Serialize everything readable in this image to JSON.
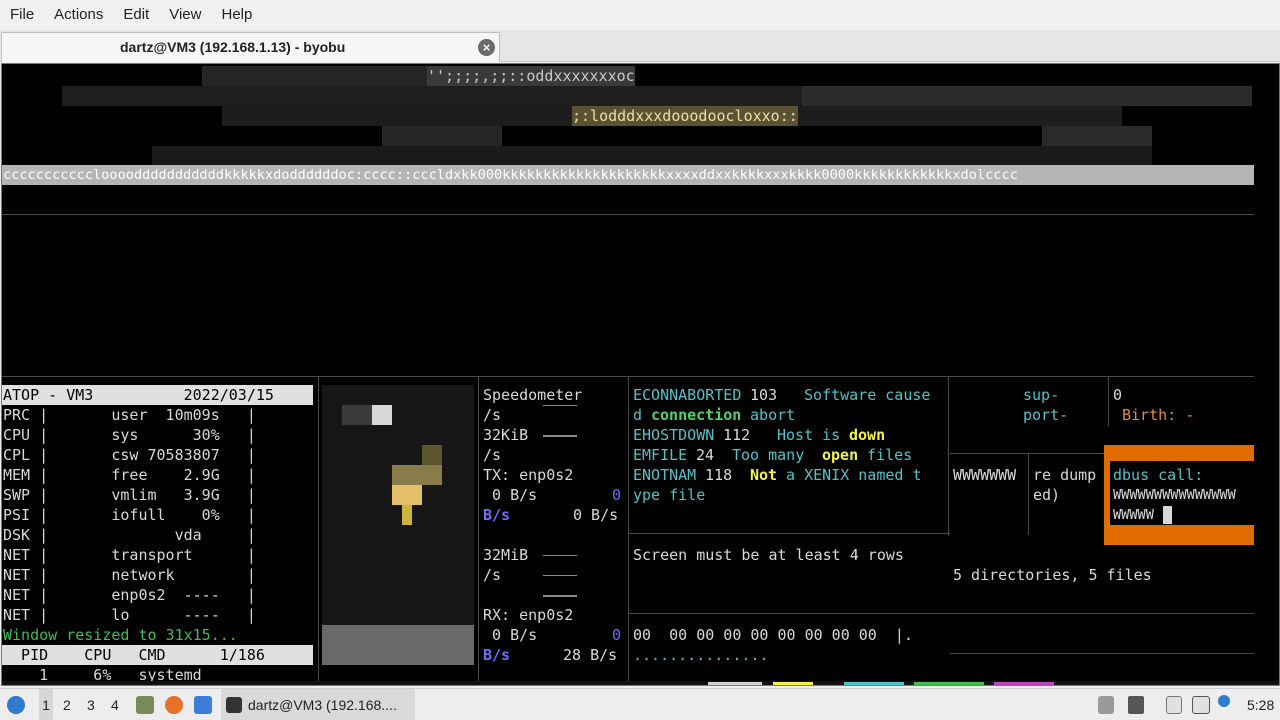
{
  "menubar": {
    "items": [
      "File",
      "Actions",
      "Edit",
      "View",
      "Help"
    ]
  },
  "tab": {
    "title": "dartz@VM3 (192.168.1.13) - byobu",
    "close": "×"
  },
  "art": {
    "row1": "'';;;;,;;::oddxxxxxxxoc",
    "row2": ";:lodddxxxdooodoocloxxo::",
    "bar": "cccccccccccloooodddddddddddkkkkkxdoddddddoc:cccc::cccldxkk000kkkkkkkkkkkkkkkkkkkkxxxxddxxkkkkxxxkkkk0000kkkkkkkkkkkkxdolcccc"
  },
  "atop": {
    "header": "ATOP - VM3          2022/03/15",
    "rows": [
      "PRC |       user  10m09s   |",
      "CPU |       sys      30%   |",
      "CPL |       csw 70583807   |",
      "MEM |       free    2.9G   |",
      "SWP |       vmlim   3.9G   |",
      "PSI |       iofull    0%   |",
      "DSK |              vda     |",
      "NET |       transport      |",
      "NET |       network        |",
      "NET |       enp0s2  ----   |",
      "NET |       lo      ----   |"
    ],
    "resized": "Window resized to 31x15...",
    "proc_header": "  PID    CPU   CMD      1/186",
    "proc_row": "    1     6%   systemd"
  },
  "speed": {
    "title": "Speedometer",
    "per_s": "/s",
    "kib": "32KiB",
    "tx": "TX: enp0s2",
    "tx_val": " 0 B/s",
    "zero": "0",
    "bs": "B/s",
    "bs_val": "0 B/s",
    "mib": "32MiB",
    "rx": "RX: enp0s2",
    "rx_val": " 0 B/s",
    "rx_bs_val": "28 B/s"
  },
  "errno": {
    "l1a": "ECONNABORTED",
    "l1b": " 103 ",
    "l1c": "Software cause",
    "l2a": "d ",
    "l2b": "connection",
    "l2c": " abort",
    "l3a": "EHOSTDOWN",
    "l3b": " 112 ",
    "l3c": "Host is ",
    "l3d": "down",
    "l4a": "EMFILE",
    "l4b": " 24 ",
    "l4c": "Too many ",
    "l4d": "open",
    "l4e": " files",
    "l5a": "ENOTNAM",
    "l5b": " 118 ",
    "l5c": "Not",
    "l5d": " a XENIX named t",
    "l6": "ype file",
    "screen_msg": "Screen must be at least 4 rows",
    "hex": "00  00 00 00 00 00 00 00 00  |.",
    "dots": "..............."
  },
  "right": {
    "support1": "sup-",
    "support2": "port-",
    "zero": "0",
    "birth": "Birth: -",
    "w": "WWWWWWW",
    "dump1": "re dump",
    "dump2": "ed)",
    "dbus1": "dbus call:",
    "dbus2": "WWWWWWWWWWWWWWW",
    "dbus3": "WWWWW",
    "dirs": "5 directories, 5 files"
  },
  "taskbar": {
    "workspaces": [
      "1",
      "2",
      "3",
      "4"
    ],
    "task": "dartz@VM3 (192.168....",
    "clock": "5:28"
  },
  "colors": {
    "teal": "#4fc3c9",
    "yellow": "#f4f24a",
    "orange": "#e06c00",
    "green": "#3fbf4f",
    "blue": "#6d6dff",
    "tab_border": "#2a8fd6"
  }
}
